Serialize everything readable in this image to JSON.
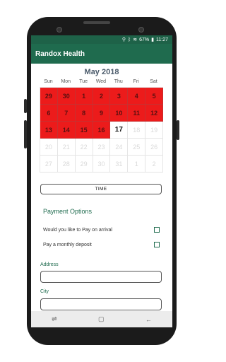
{
  "status_bar": {
    "battery": "67%",
    "time": "11:27"
  },
  "app_bar": {
    "title": "Randox Health"
  },
  "calendar": {
    "month_label": "May 2018",
    "weekdays": [
      "Sun",
      "Mon",
      "Tue",
      "Wed",
      "Thu",
      "Fri",
      "Sat"
    ],
    "weeks": [
      [
        "29",
        "30",
        "1",
        "2",
        "3",
        "4",
        "5"
      ],
      [
        "6",
        "7",
        "8",
        "9",
        "10",
        "11",
        "12"
      ],
      [
        "13",
        "14",
        "15",
        "16",
        "17",
        "18",
        "19"
      ],
      [
        "20",
        "21",
        "22",
        "23",
        "24",
        "25",
        "26"
      ],
      [
        "27",
        "28",
        "29",
        "30",
        "31",
        "1",
        "2"
      ]
    ],
    "booked_color": "#ec1b1b",
    "today": "17"
  },
  "time_button": {
    "label": "TIME"
  },
  "payment": {
    "title": "Payment Options",
    "options": [
      {
        "label": "Would you like to Pay on arrival"
      },
      {
        "label": "Pay a monthly deposit"
      }
    ]
  },
  "form": {
    "address_label": "Address",
    "city_label": "City"
  },
  "nav_icons": [
    "recent-apps-icon",
    "home-icon",
    "back-icon"
  ],
  "colors": {
    "primary": "#1f6b4e",
    "status_bar": "#1e6248"
  }
}
